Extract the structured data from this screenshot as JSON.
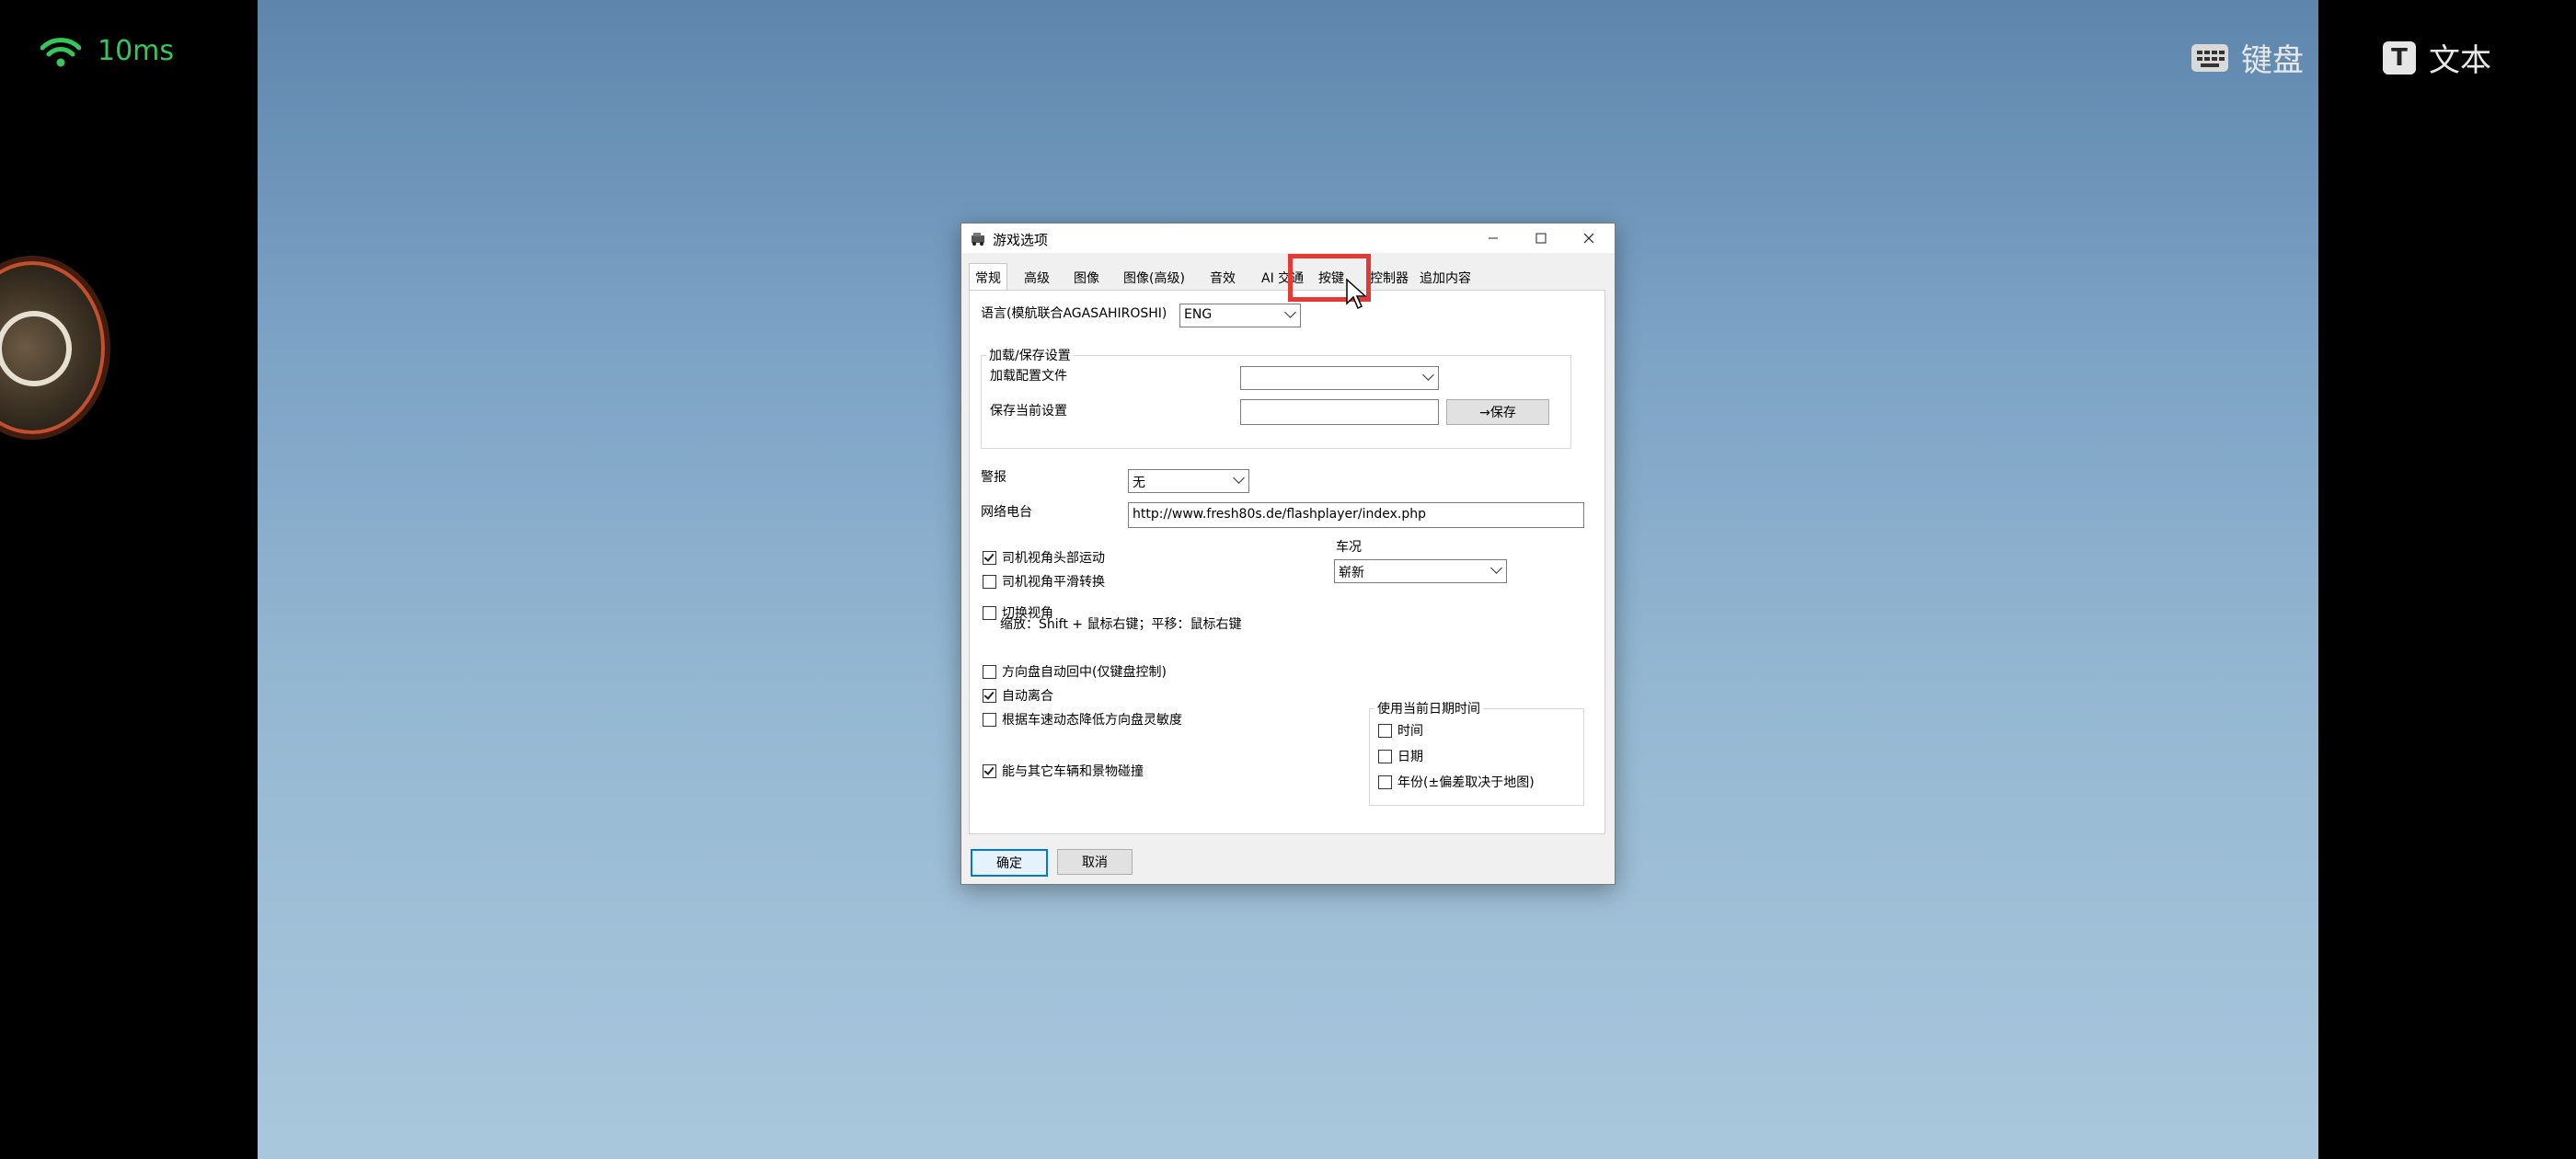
{
  "overlay": {
    "ping": "10ms",
    "keyboard_label": "键盘",
    "text_label": "文本"
  },
  "dialog": {
    "title": "游戏选项",
    "tabs": [
      "常规",
      "高级",
      "图像",
      "图像(高级)",
      "音效",
      "AI 交通",
      "按键",
      "控制器",
      "追加内容"
    ],
    "active_tab": "常规",
    "language_label": "语言(模航联合AGASAHIROSHI)",
    "language_value": "ENG",
    "load_save_group": "加载/保存设置",
    "load_config_label": "加载配置文件",
    "load_config_value": "",
    "save_current_label": "保存当前设置",
    "save_current_value": "",
    "save_button": "→保存",
    "alarm_label": "警报",
    "alarm_value": "无",
    "radio_label": "网络电台",
    "radio_url": "http://www.fresh80s.de/flashplayer/index.php",
    "car_condition_label": "车况",
    "car_condition_value": "崭新",
    "checks": {
      "head_motion": {
        "label": "司机视角头部运动",
        "checked": true
      },
      "smooth_switch": {
        "label": "司机视角平滑转换",
        "checked": false
      },
      "switch_view": {
        "label": "切换视角",
        "checked": false
      },
      "switch_view_hint": "缩放：Shift + 鼠标右键；平移：鼠标右键",
      "auto_center": {
        "label": "方向盘自动回中(仅键盘控制)",
        "checked": false
      },
      "auto_clutch": {
        "label": "自动离合",
        "checked": true
      },
      "reduce_sensitivity": {
        "label": "根据车速动态降低方向盘灵敏度",
        "checked": false
      },
      "collide": {
        "label": "能与其它车辆和景物碰撞",
        "checked": true
      }
    },
    "datetime_group": "使用当前日期时间",
    "datetime_checks": {
      "time": {
        "label": "时间",
        "checked": false
      },
      "date": {
        "label": "日期",
        "checked": false
      },
      "year": {
        "label": "年份(±偏差取决于地图)",
        "checked": false
      }
    },
    "ok_button": "确定",
    "cancel_button": "取消"
  }
}
